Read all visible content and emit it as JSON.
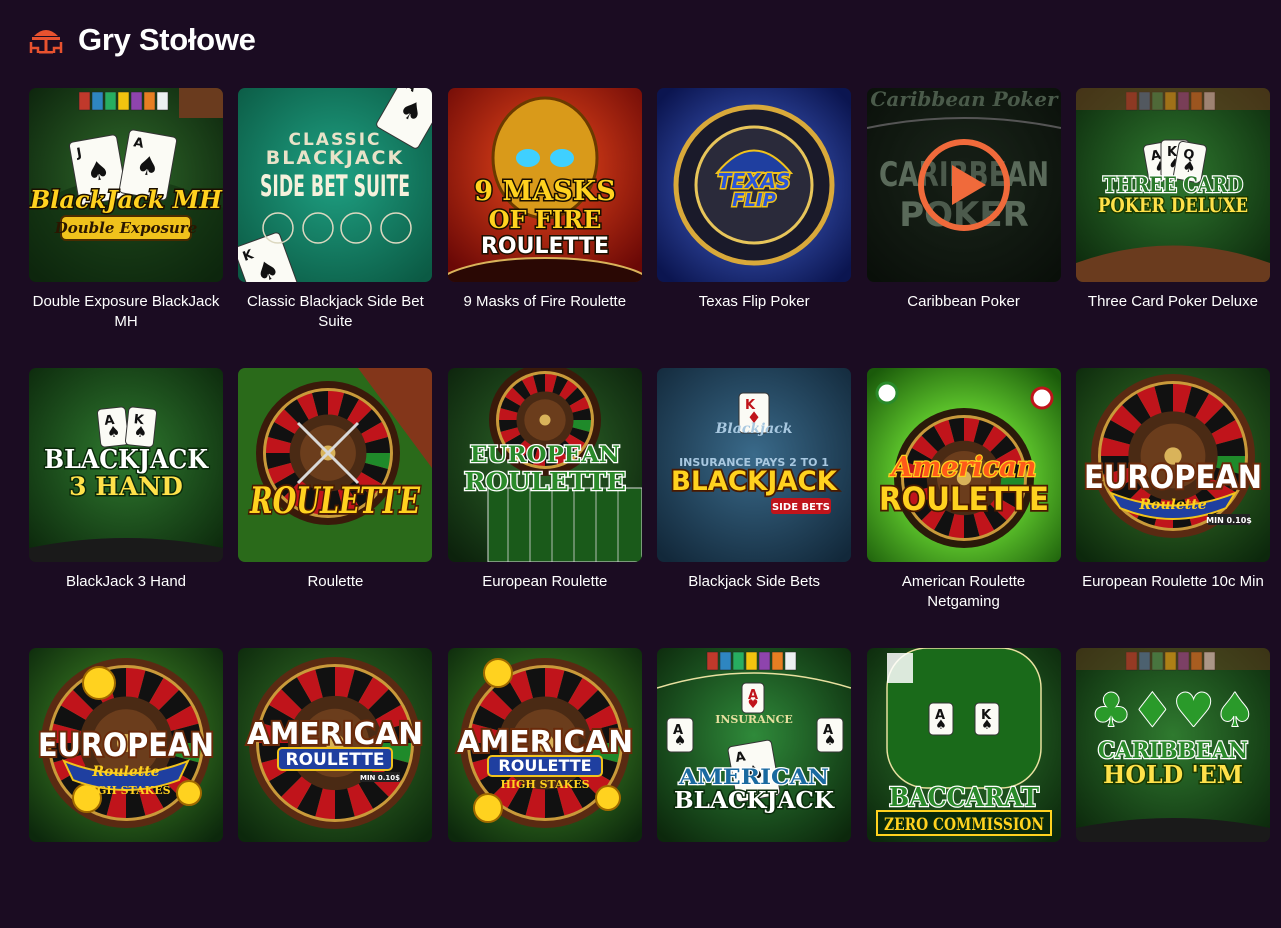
{
  "header": {
    "title": "Gry Stołowe",
    "icon": "dining-table-icon",
    "accent": "#e8522f"
  },
  "play_overlay": {
    "icon": "play-icon",
    "color": "#f06a3b"
  },
  "games": [
    {
      "name": "Double Exposure BlackJack MH",
      "title_art": [
        "BlackJack MH",
        "Double Exposure"
      ],
      "theme": "blackjack"
    },
    {
      "name": "Classic Blackjack Side Bet Suite",
      "title_art": [
        "CLASSIC",
        "BLACKJACK",
        "SIDE BET SUITE"
      ],
      "theme": "side-bet"
    },
    {
      "name": "9 Masks of Fire Roulette",
      "title_art": [
        "9 MASKS",
        "OF FIRE",
        "ROULETTE"
      ],
      "theme": "fire"
    },
    {
      "name": "Texas Flip Poker",
      "title_art": [
        "TEXAS",
        "FLIP"
      ],
      "theme": "texas"
    },
    {
      "name": "Caribbean Poker",
      "title_art": [
        "Caribbean Poker",
        "CARIBBEAN",
        "POKER"
      ],
      "theme": "caribbean",
      "hovered": true
    },
    {
      "name": "Three Card Poker Deluxe",
      "title_art": [
        "THREE CARD",
        "POKER DELUXE"
      ],
      "theme": "three-card"
    },
    {
      "name": "BlackJack 3 Hand",
      "title_art": [
        "BLACKJACK",
        "3 HAND"
      ],
      "theme": "bj3"
    },
    {
      "name": "Roulette",
      "title_art": [
        "ROULETTE"
      ],
      "theme": "roulette"
    },
    {
      "name": "European Roulette",
      "title_art": [
        "EUROPEAN",
        "ROULETTE"
      ],
      "theme": "eu-roulette"
    },
    {
      "name": "Blackjack Side Bets",
      "title_art": [
        "BLACKJACK",
        "SIDE BETS"
      ],
      "theme": "bj-side"
    },
    {
      "name": "American Roulette Netgaming",
      "title_art": [
        "American",
        "ROULETTE"
      ],
      "theme": "am-roulette"
    },
    {
      "name": "European Roulette 10c Min",
      "title_art": [
        "EUROPEAN",
        "Roulette",
        "MIN 0.10$"
      ],
      "theme": "eu-10c"
    },
    {
      "name": "",
      "title_art": [
        "EUROPEAN",
        "Roulette",
        "HIGH STAKES"
      ],
      "theme": "eu-hs"
    },
    {
      "name": "",
      "title_art": [
        "AMERICAN",
        "ROULETTE",
        "MIN 0.10$"
      ],
      "theme": "am-wheel"
    },
    {
      "name": "",
      "title_art": [
        "AMERICAN",
        "ROULETTE",
        "HIGH STAKES"
      ],
      "theme": "am-hs"
    },
    {
      "name": "",
      "title_art": [
        "AMERICAN",
        "BLACKJACK"
      ],
      "theme": "am-bj"
    },
    {
      "name": "",
      "title_art": [
        "BACCARAT",
        "ZERO COMMISSION"
      ],
      "theme": "baccarat"
    },
    {
      "name": "",
      "title_art": [
        "CARIBBEAN",
        "HOLD 'EM"
      ],
      "theme": "holdem"
    }
  ]
}
